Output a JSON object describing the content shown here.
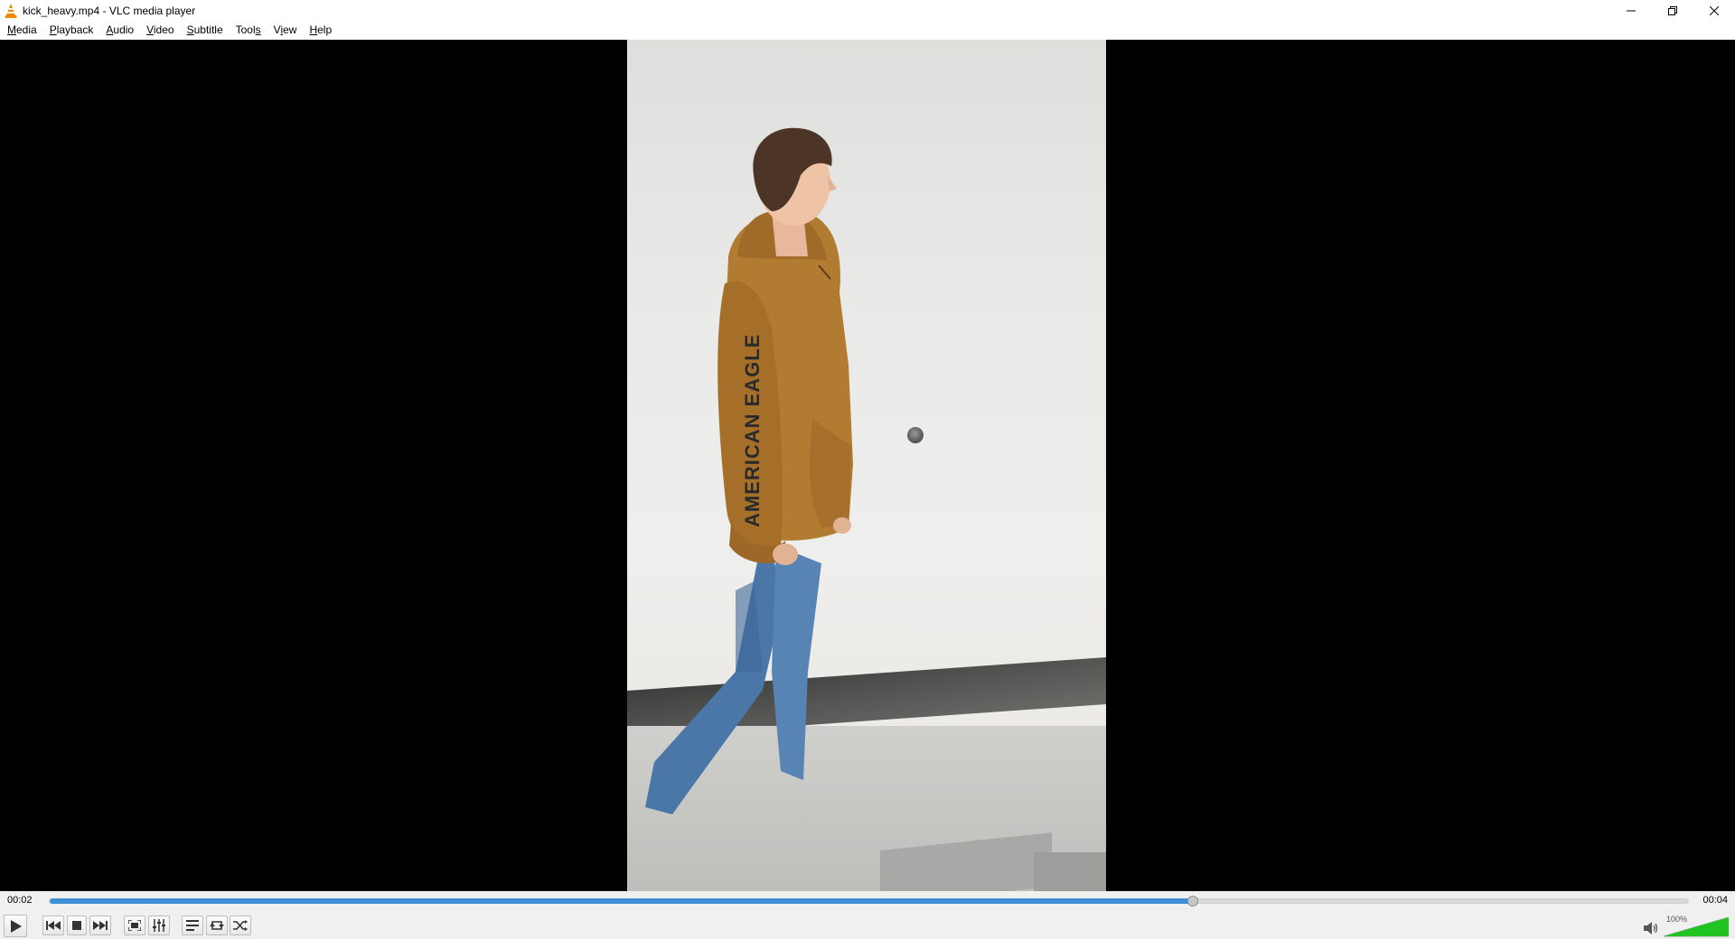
{
  "window": {
    "title": "kick_heavy.mp4 - VLC media player",
    "app_icon": "vlc-cone-icon",
    "controls": [
      "minimize-icon",
      "restore-icon",
      "close-icon"
    ]
  },
  "menu": [
    {
      "label": "Media",
      "accel": "M",
      "rest": "edia"
    },
    {
      "label": "Playback",
      "accel": "P",
      "rest": "layback"
    },
    {
      "label": "Audio",
      "accel": "A",
      "rest": "udio"
    },
    {
      "label": "Video",
      "accel": "V",
      "rest": "ideo"
    },
    {
      "label": "Subtitle",
      "accel": "S",
      "rest": "ubtitle"
    },
    {
      "label": "Tools",
      "pre": "Tool",
      "accel": "s",
      "rest": ""
    },
    {
      "label": "View",
      "pre": "V",
      "accel": "i",
      "rest": "ew"
    },
    {
      "label": "Help",
      "accel": "H",
      "rest": "elp"
    }
  ],
  "video": {
    "sleeve_text": "AMERICAN EAGLE"
  },
  "playback": {
    "elapsed": "00:02",
    "total": "00:04",
    "progress_fraction": 0.697
  },
  "controls": [
    {
      "name": "play-button",
      "icon": "play-icon"
    },
    {
      "name": "previous-button",
      "icon": "skip-previous-icon"
    },
    {
      "name": "stop-button",
      "icon": "stop-icon"
    },
    {
      "name": "next-button",
      "icon": "skip-next-icon"
    },
    {
      "name": "fullscreen-button",
      "icon": "fullscreen-icon"
    },
    {
      "name": "extended-settings-button",
      "icon": "equalizer-icon"
    },
    {
      "name": "playlist-button",
      "icon": "playlist-icon"
    },
    {
      "name": "loop-button",
      "icon": "loop-icon"
    },
    {
      "name": "random-button",
      "icon": "shuffle-icon"
    }
  ],
  "volume": {
    "label": "100%",
    "level": 1.0,
    "color": "#21c321"
  }
}
